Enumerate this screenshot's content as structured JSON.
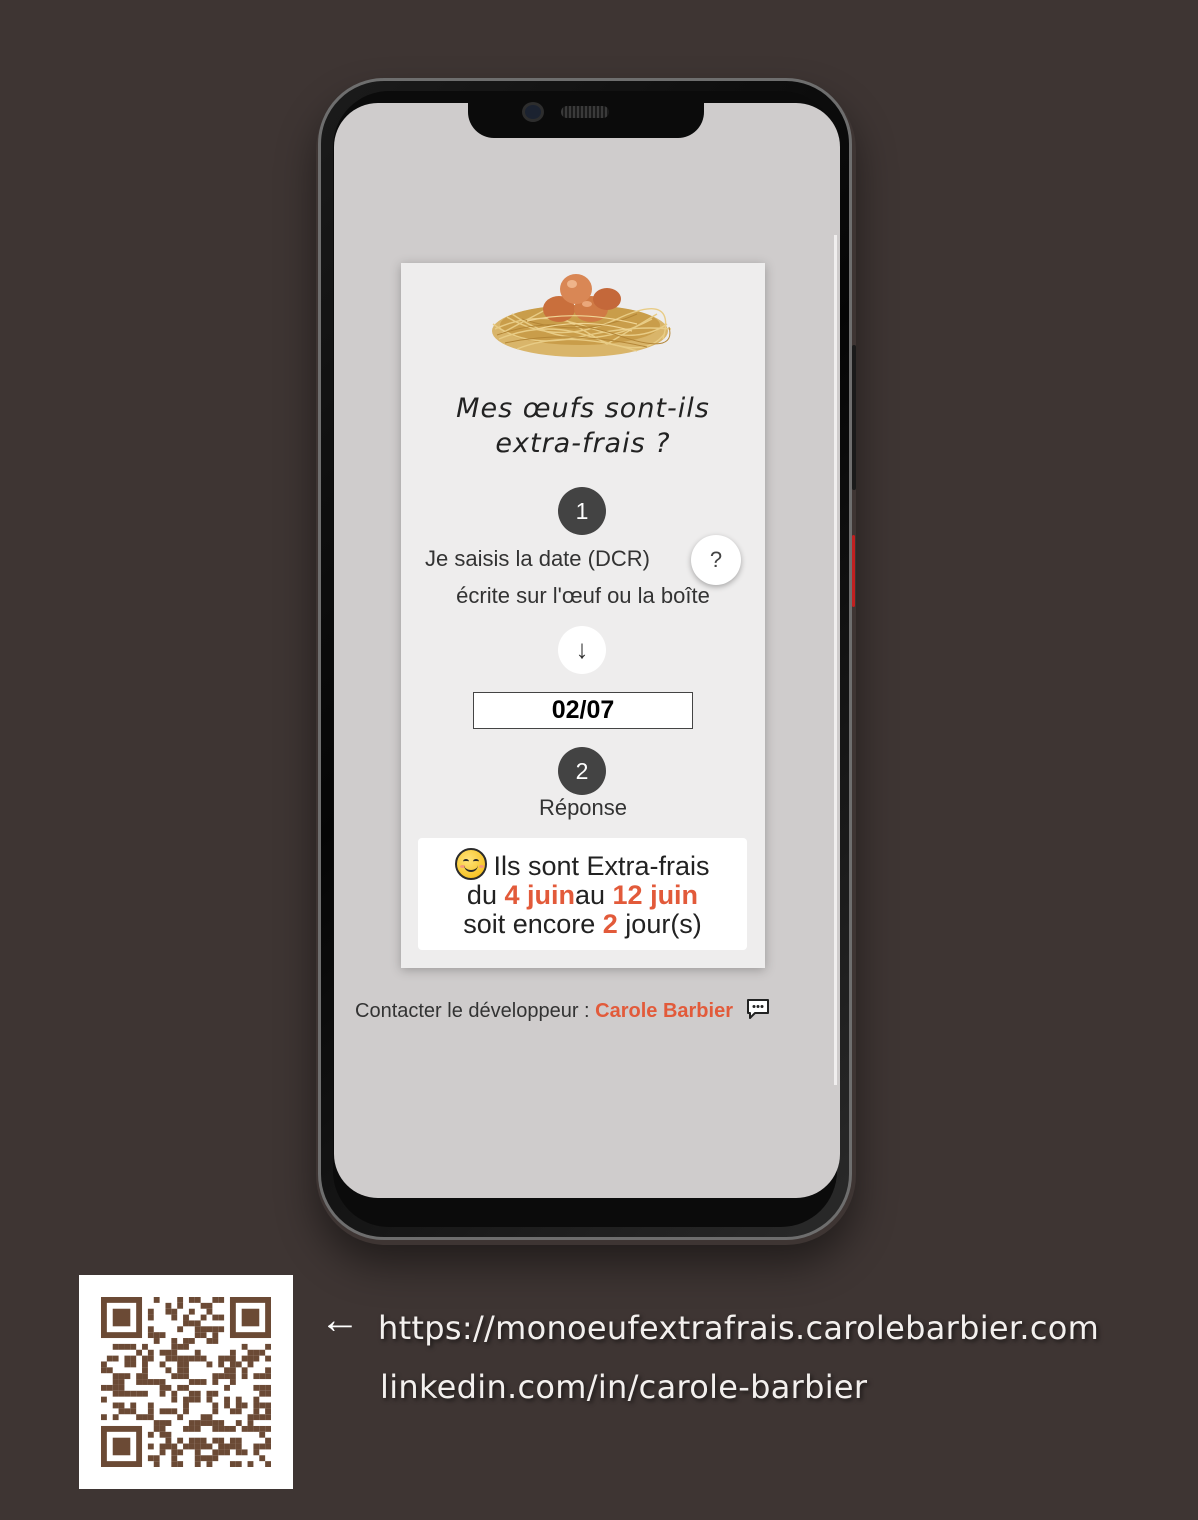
{
  "app": {
    "title": "Mes œufs sont-ils extra-frais ?",
    "title_line1": "Mes œufs sont-ils",
    "title_line2": "extra-frais ?"
  },
  "steps": {
    "step1_number": "1",
    "step1_text_line1": "Je saisis la date (DCR)",
    "step1_text_line2": "écrite sur l'œuf ou la boîte",
    "help_label": "?",
    "down_arrow": "↓",
    "step2_number": "2",
    "step2_label": "Réponse"
  },
  "date_input": {
    "value": "02/07"
  },
  "result": {
    "emoji": "smiling-face-icon",
    "line1": "Ils sont Extra-frais",
    "du": "du ",
    "start": "4 juin",
    "au": "au ",
    "end": "12 juin",
    "soit": "soit encore ",
    "days": "2",
    "jours": " jour(s)"
  },
  "footer": {
    "contact_label": "Contacter le développeur : ",
    "contact_name": "Carole Barbier",
    "chat_icon": "chat-bubble-icon"
  },
  "links": {
    "arrow": "←",
    "website": "https://monoeufextrafrais.carolebarbier.com",
    "linkedin": "linkedin.com/in/carole-barbier"
  },
  "colors": {
    "background": "#3e3533",
    "accent": "#e25a3a",
    "qr": "#6b4a35"
  }
}
